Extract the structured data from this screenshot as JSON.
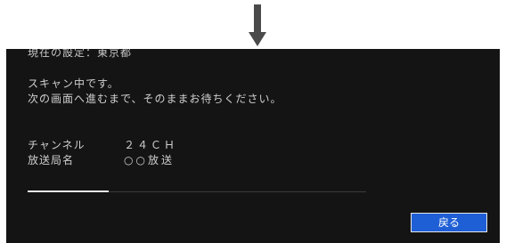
{
  "setting_line": "現在の設定：東京都",
  "message": {
    "line1": "スキャン中です。",
    "line2": "次の画面へ進むまで、そのままお待ちください。"
  },
  "info": {
    "channel_label": "チャンネル",
    "channel_value": "２４ＣＨ",
    "station_label": "放送局名",
    "station_value": "○○放送"
  },
  "progress": {
    "fraction": 0.24
  },
  "buttons": {
    "back_label": "戻る"
  },
  "colors": {
    "screen_bg": "#141414",
    "button_bg": "#1f5fd6",
    "arrow": "#4a4a4a"
  },
  "icons": {
    "arrow": "down-arrow-icon"
  }
}
